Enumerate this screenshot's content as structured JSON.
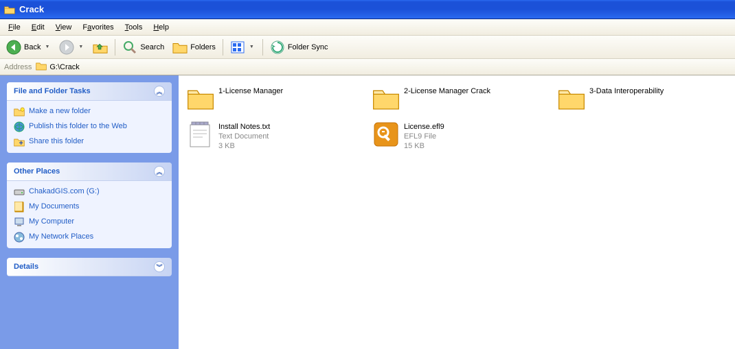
{
  "window": {
    "title": "Crack"
  },
  "menubar": {
    "items": [
      "File",
      "Edit",
      "View",
      "Favorites",
      "Tools",
      "Help"
    ]
  },
  "toolbar": {
    "back": "Back",
    "search": "Search",
    "folders": "Folders",
    "foldersync": "Folder Sync"
  },
  "addressbar": {
    "label": "Address",
    "path": "G:\\Crack"
  },
  "sidebar": {
    "panels": [
      {
        "title": "File and Folder Tasks",
        "collapsed": false,
        "chevron": "︽",
        "items": [
          {
            "icon": "folder-new-icon",
            "label": "Make a new folder"
          },
          {
            "icon": "globe-publish-icon",
            "label": "Publish this folder to the Web"
          },
          {
            "icon": "folder-share-icon",
            "label": "Share this folder"
          }
        ]
      },
      {
        "title": "Other Places",
        "collapsed": false,
        "chevron": "︽",
        "items": [
          {
            "icon": "drive-icon",
            "label": "ChakadGIS.com (G:)"
          },
          {
            "icon": "documents-icon",
            "label": "My Documents"
          },
          {
            "icon": "computer-icon",
            "label": "My Computer"
          },
          {
            "icon": "network-places-icon",
            "label": "My Network Places"
          }
        ]
      },
      {
        "title": "Details",
        "collapsed": true,
        "chevron": "︾",
        "items": []
      }
    ]
  },
  "content": {
    "items": [
      {
        "type": "folder",
        "name": "1-License Manager",
        "meta1": "",
        "meta2": ""
      },
      {
        "type": "folder",
        "name": "2-License Manager Crack",
        "meta1": "",
        "meta2": ""
      },
      {
        "type": "folder",
        "name": "3-Data Interoperability",
        "meta1": "",
        "meta2": ""
      },
      {
        "type": "txt",
        "name": "Install Notes.txt",
        "meta1": "Text Document",
        "meta2": "3 KB"
      },
      {
        "type": "efl9",
        "name": "License.efl9",
        "meta1": "EFL9 File",
        "meta2": "15 KB"
      }
    ]
  }
}
